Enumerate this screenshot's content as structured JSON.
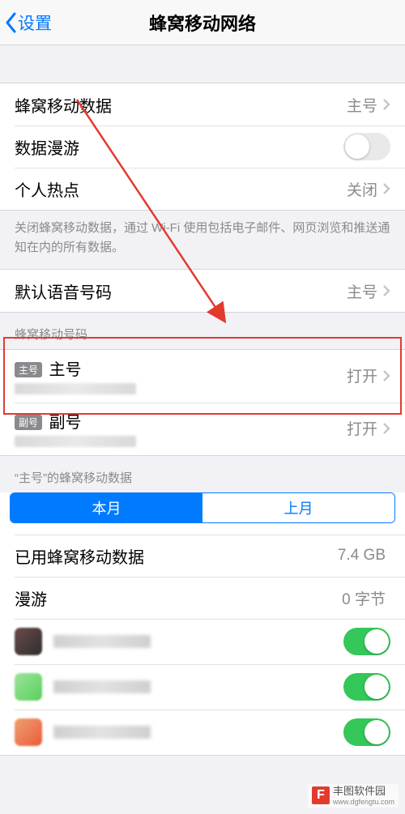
{
  "nav": {
    "back": "设置",
    "title": "蜂窝移动网络"
  },
  "cellular": {
    "data_label": "蜂窝移动数据",
    "data_value": "主号",
    "roaming_label": "数据漫游",
    "roaming_on": false,
    "hotspot_label": "个人热点",
    "hotspot_value": "关闭",
    "footer": "关闭蜂窝移动数据，通过 Wi-Fi 使用包括电子邮件、网页浏览和推送通知在内的所有数据。"
  },
  "voice": {
    "label": "默认语音号码",
    "value": "主号"
  },
  "sims": {
    "header": "蜂窝移动号码",
    "items": [
      {
        "tag": "主号",
        "name": "主号",
        "status": "打开"
      },
      {
        "tag": "副号",
        "name": "副号",
        "status": "打开"
      }
    ]
  },
  "usage": {
    "header": "“主号”的蜂窝移动数据",
    "tabs": {
      "current": "本月",
      "previous": "上月"
    },
    "total_label": "已用蜂窝移动数据",
    "total_value": "7.4 GB",
    "roaming_label": "漫游",
    "roaming_value": "0 字节",
    "apps": [
      {
        "on": true,
        "icon": "linear-gradient(135deg,#6b4b4b,#2e2e2e)"
      },
      {
        "on": true,
        "icon": "linear-gradient(135deg,#9be49b,#5bcf5b)"
      },
      {
        "on": true,
        "icon": "linear-gradient(135deg,#f0a070,#e85c3a)"
      }
    ]
  },
  "watermark": {
    "logo": "F",
    "name": "丰图软件园",
    "url": "www.dgfengtu.com"
  }
}
